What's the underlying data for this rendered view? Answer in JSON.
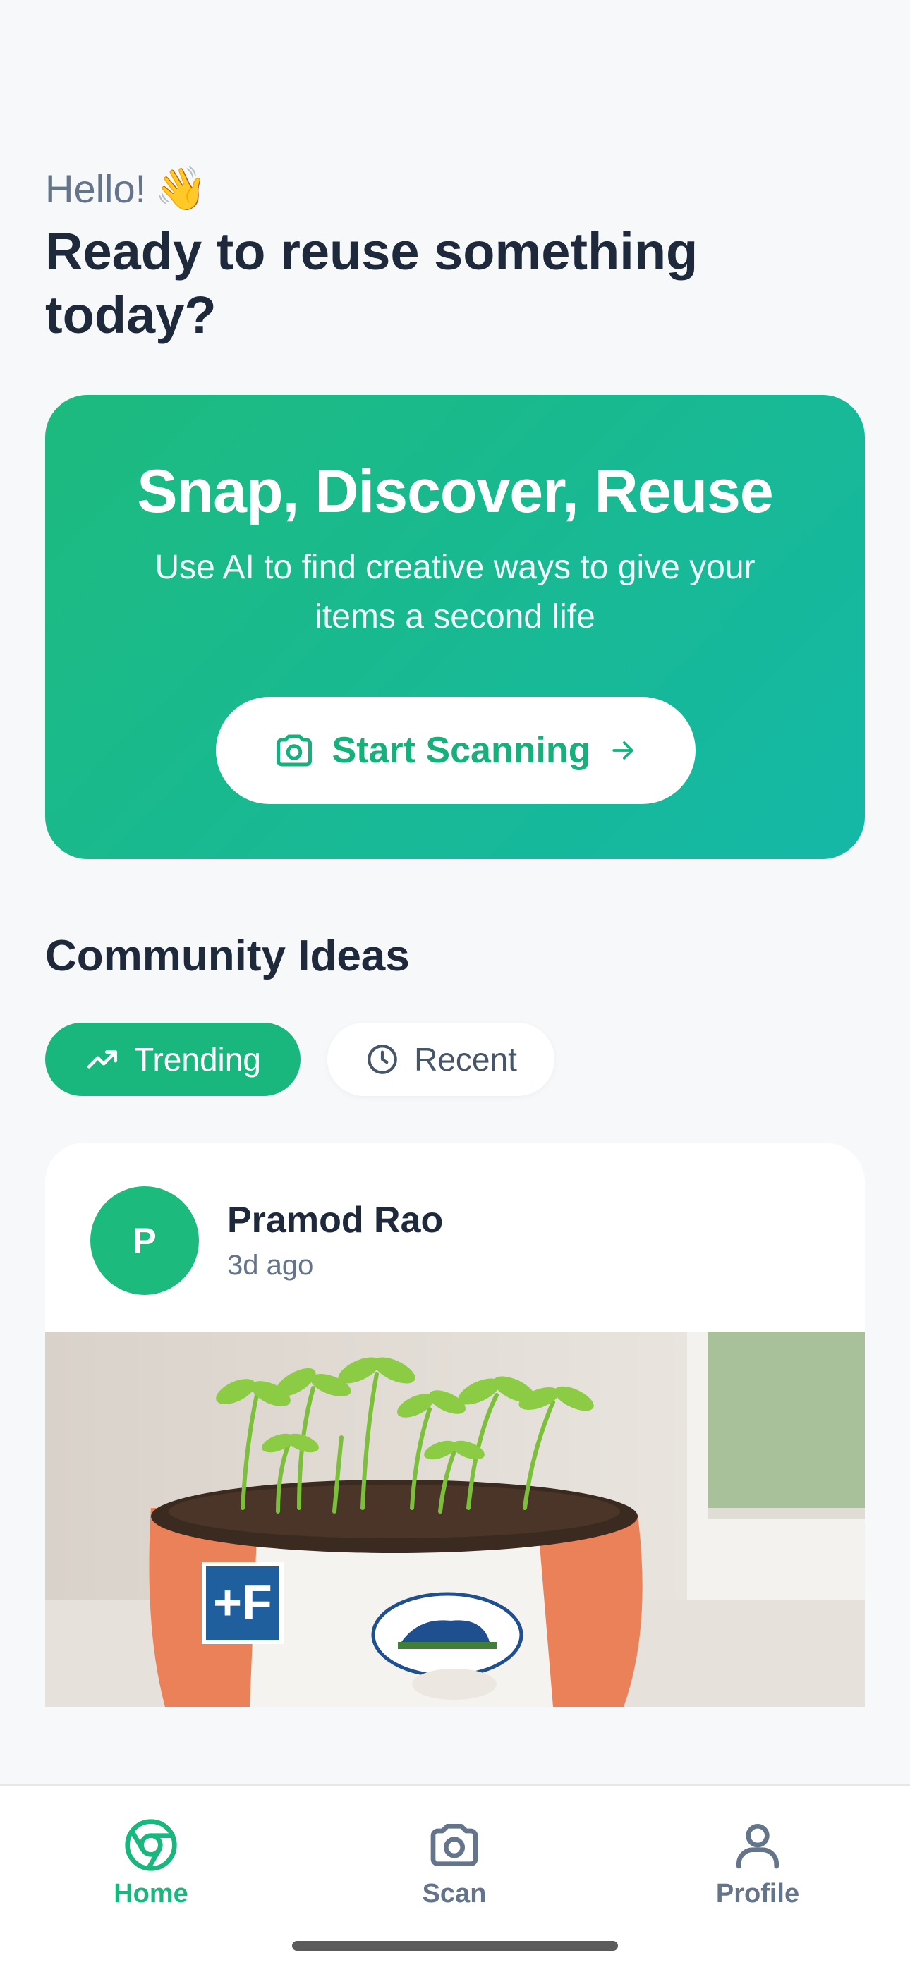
{
  "greeting": {
    "text": "Hello!",
    "emoji": "👋"
  },
  "headline": "Ready to reuse something today?",
  "hero": {
    "title": "Snap, Discover, Reuse",
    "subtitle": "Use AI to find creative ways to give your items a second life",
    "button_label": "Start Scanning",
    "gradient": [
      "#1dba7e",
      "#14b8a6"
    ]
  },
  "community": {
    "title": "Community Ideas",
    "filters": [
      {
        "label": "Trending",
        "icon": "trending-up-icon",
        "active": true
      },
      {
        "label": "Recent",
        "icon": "clock-icon",
        "active": false
      }
    ]
  },
  "post": {
    "avatar_initial": "P",
    "author": "Pramod Rao",
    "time": "3d ago",
    "image_description_icon": "seedlings-in-reused-milk-packet-image"
  },
  "tabbar": {
    "items": [
      {
        "label": "Home",
        "icon": "home-circle-icon",
        "active": true
      },
      {
        "label": "Scan",
        "icon": "camera-icon",
        "active": false
      },
      {
        "label": "Profile",
        "icon": "user-icon",
        "active": false
      }
    ]
  },
  "colors": {
    "accent": "#19b77d",
    "text": "#1e293b",
    "muted": "#64748b",
    "background": "#f6f8fa"
  }
}
